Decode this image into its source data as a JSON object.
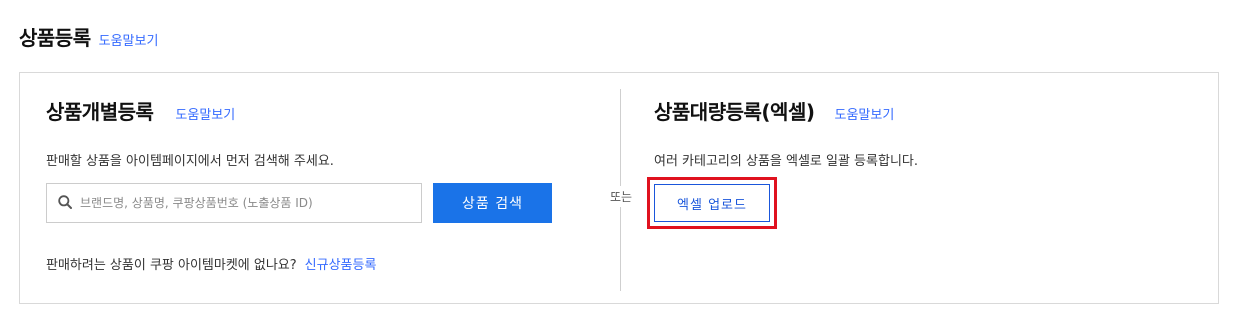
{
  "header": {
    "title": "상품등록",
    "help_label": "도움말보기"
  },
  "individual": {
    "title": "상품개별등록",
    "help_label": "도움말보기",
    "description": "판매할 상품을 아이템페이지에서 먼저 검색해 주세요.",
    "search": {
      "value": "",
      "placeholder": "브랜드명, 상품명, 쿠팡상품번호 (노출상품 ID)"
    },
    "search_button_label": "상품 검색",
    "footer_text": "판매하려는 상품이 쿠팡 아이템마켓에 없나요?",
    "new_product_link": "신규상품등록"
  },
  "divider_label": "또는",
  "bulk": {
    "title": "상품대량등록(엑셀)",
    "help_label": "도움말보기",
    "description": "여러 카테고리의 상품을 엑셀로 일괄 등록합니다.",
    "excel_upload_label": "엑셀 업로드"
  },
  "icons": {
    "search": "search-icon"
  },
  "colors": {
    "link": "#346aff",
    "primary_button": "#1a73e8",
    "outline_button": "#1a56db",
    "highlight": "#e0121f"
  }
}
